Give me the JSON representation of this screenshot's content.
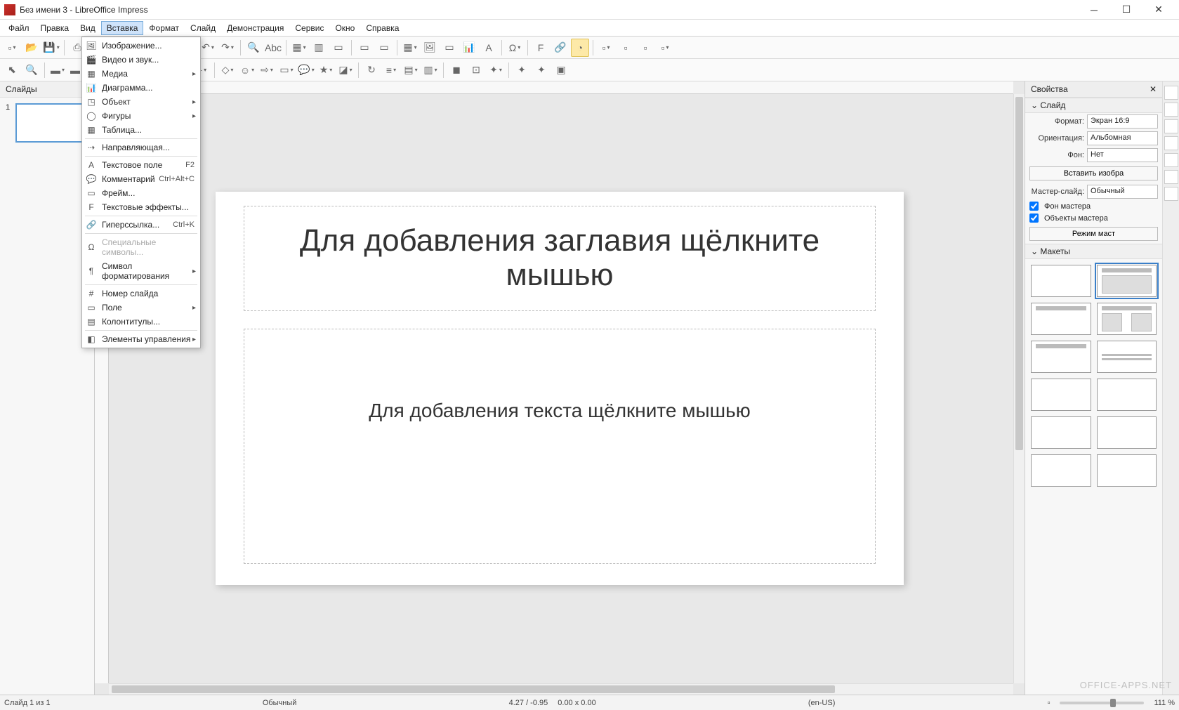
{
  "window": {
    "title": "Без имени 3 - LibreOffice Impress"
  },
  "menubar": [
    "Файл",
    "Правка",
    "Вид",
    "Вставка",
    "Формат",
    "Слайд",
    "Демонстрация",
    "Сервис",
    "Окно",
    "Справка"
  ],
  "active_menu_index": 3,
  "dropdown": {
    "items": [
      {
        "icon": "🖼",
        "label": "Изображение...",
        "type": "item"
      },
      {
        "icon": "🎬",
        "label": "Видео и звук...",
        "type": "item"
      },
      {
        "icon": "▦",
        "label": "Медиа",
        "type": "sub"
      },
      {
        "icon": "📊",
        "label": "Диаграмма...",
        "type": "item"
      },
      {
        "icon": "◳",
        "label": "Объект",
        "type": "sub"
      },
      {
        "icon": "◯",
        "label": "Фигуры",
        "type": "sub"
      },
      {
        "icon": "▦",
        "label": "Таблица...",
        "type": "item"
      },
      {
        "type": "sep"
      },
      {
        "icon": "⇢",
        "label": "Направляющая...",
        "type": "item"
      },
      {
        "type": "sep"
      },
      {
        "icon": "A",
        "label": "Текстовое поле",
        "shortcut": "F2",
        "type": "item"
      },
      {
        "icon": "💬",
        "label": "Комментарий",
        "shortcut": "Ctrl+Alt+C",
        "type": "item"
      },
      {
        "icon": "▭",
        "label": "Фрейм...",
        "type": "item"
      },
      {
        "icon": "F",
        "label": "Текстовые эффекты...",
        "type": "item"
      },
      {
        "type": "sep"
      },
      {
        "icon": "🔗",
        "label": "Гиперссылка...",
        "shortcut": "Ctrl+K",
        "type": "item"
      },
      {
        "type": "sep"
      },
      {
        "icon": "Ω",
        "label": "Специальные символы...",
        "type": "item",
        "disabled": true
      },
      {
        "icon": "¶",
        "label": "Символ форматирования",
        "type": "sub"
      },
      {
        "type": "sep"
      },
      {
        "icon": "#",
        "label": "Номер слайда",
        "type": "item"
      },
      {
        "icon": "▭",
        "label": "Поле",
        "type": "sub"
      },
      {
        "icon": "▤",
        "label": "Колонтитулы...",
        "type": "item"
      },
      {
        "type": "sep"
      },
      {
        "icon": "◧",
        "label": "Элементы управления",
        "type": "sub"
      }
    ]
  },
  "slide_panel": {
    "header": "Слайды",
    "slides": [
      {
        "number": "1"
      }
    ]
  },
  "canvas": {
    "title_placeholder": "Для добавления заглавия щёлкните мышью",
    "body_placeholder": "Для добавления текста щёлкните мышью"
  },
  "sidebar": {
    "header": "Свойства",
    "slide_section": {
      "title": "Слайд",
      "format_label": "Формат:",
      "format_value": "Экран 16:9",
      "orientation_label": "Ориентация:",
      "orientation_value": "Альбомная",
      "background_label": "Фон:",
      "background_value": "Нет",
      "insert_image_btn": "Вставить изобра",
      "master_label": "Мастер-слайд:",
      "master_value": "Обычный",
      "master_bg_chk": "Фон мастера",
      "master_obj_chk": "Объекты мастера",
      "master_mode_btn": "Режим маст"
    },
    "layouts_section": {
      "title": "Макеты"
    }
  },
  "statusbar": {
    "slide_info": "Слайд 1 из 1",
    "master": "Обычный",
    "coords": "4.27 / -0.95",
    "size": "0.00 x 0.00",
    "lang": "(en-US)",
    "zoom": "111 %"
  },
  "watermark": "OFFICE-APPS.NET"
}
